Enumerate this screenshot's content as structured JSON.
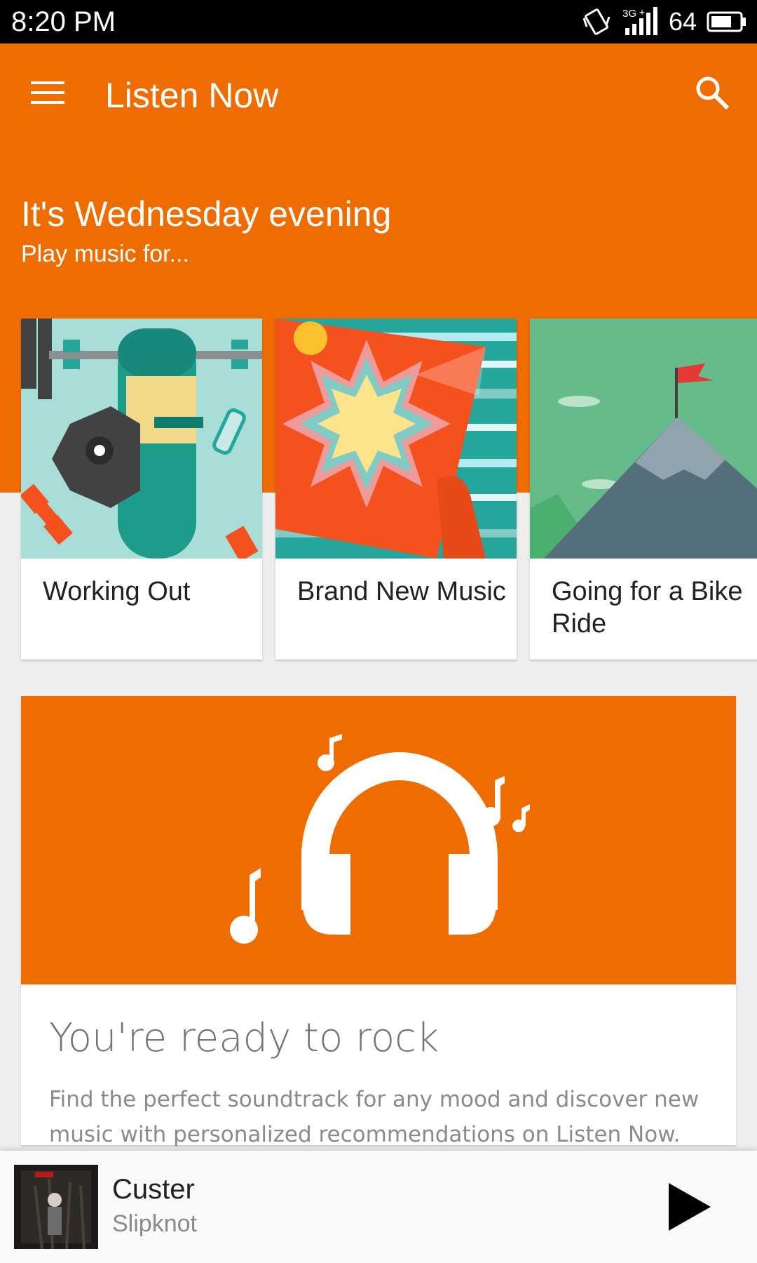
{
  "status_bar": {
    "time": "8:20 PM",
    "network": "3G",
    "battery": "64",
    "icons": [
      "vibrate-icon",
      "signal-icon",
      "battery-icon"
    ]
  },
  "toolbar": {
    "title": "Listen Now",
    "menu_icon": "hamburger-menu-icon",
    "search_icon": "search-icon"
  },
  "greeting": {
    "title": "It's Wednesday evening",
    "subtitle": "Play music for..."
  },
  "activity_cards": [
    {
      "label": "Working Out",
      "art": "gym-equipment-illustration"
    },
    {
      "label": "Brand New Music",
      "art": "starburst-record-illustration"
    },
    {
      "label": "Going for a Bike Ride",
      "art": "mountain-flag-illustration"
    }
  ],
  "promo": {
    "title": "You're ready to rock",
    "body": "Find the perfect soundtrack for any mood and discover new music with personalized recommendations on Listen Now.",
    "art": "headphones-music-notes-icon"
  },
  "now_playing": {
    "title": "Custer",
    "artist": "Slipknot",
    "play_icon": "play-icon"
  },
  "colors": {
    "accent": "#ef6c00",
    "background": "#eeeeee"
  }
}
